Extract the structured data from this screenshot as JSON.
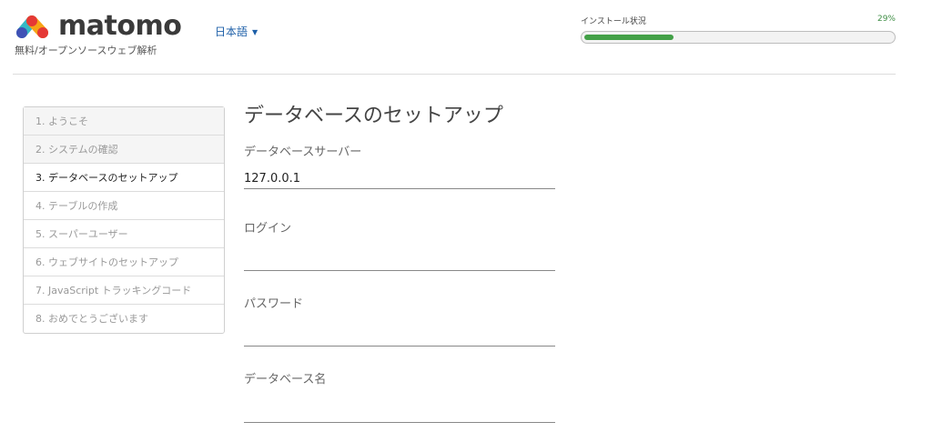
{
  "header": {
    "logo_text": "matomo",
    "tagline": "無料/オープンソースウェブ解析",
    "language": "日本語",
    "progress_label": "インストール状況",
    "progress_percent_text": "29%",
    "progress_value": 0.29
  },
  "steps": [
    {
      "label": "1. ようこそ",
      "state": "done"
    },
    {
      "label": "2. システムの確認",
      "state": "done"
    },
    {
      "label": "3. データベースのセットアップ",
      "state": "current"
    },
    {
      "label": "4. テーブルの作成",
      "state": "pending"
    },
    {
      "label": "5. スーパーユーザー",
      "state": "pending"
    },
    {
      "label": "6. ウェブサイトのセットアップ",
      "state": "pending"
    },
    {
      "label": "7. JavaScript トラッキングコード",
      "state": "pending"
    },
    {
      "label": "8. おめでとうございます",
      "state": "pending"
    }
  ],
  "main": {
    "title": "データベースのセットアップ",
    "fields": {
      "server": {
        "label": "データベースサーバー",
        "value": "127.0.0.1"
      },
      "login": {
        "label": "ログイン",
        "value": ""
      },
      "password": {
        "label": "パスワード",
        "value": ""
      },
      "dbname": {
        "label": "データベース名",
        "value": ""
      }
    }
  },
  "colors": {
    "accent": "#43a047",
    "link": "#1d5fa8"
  }
}
